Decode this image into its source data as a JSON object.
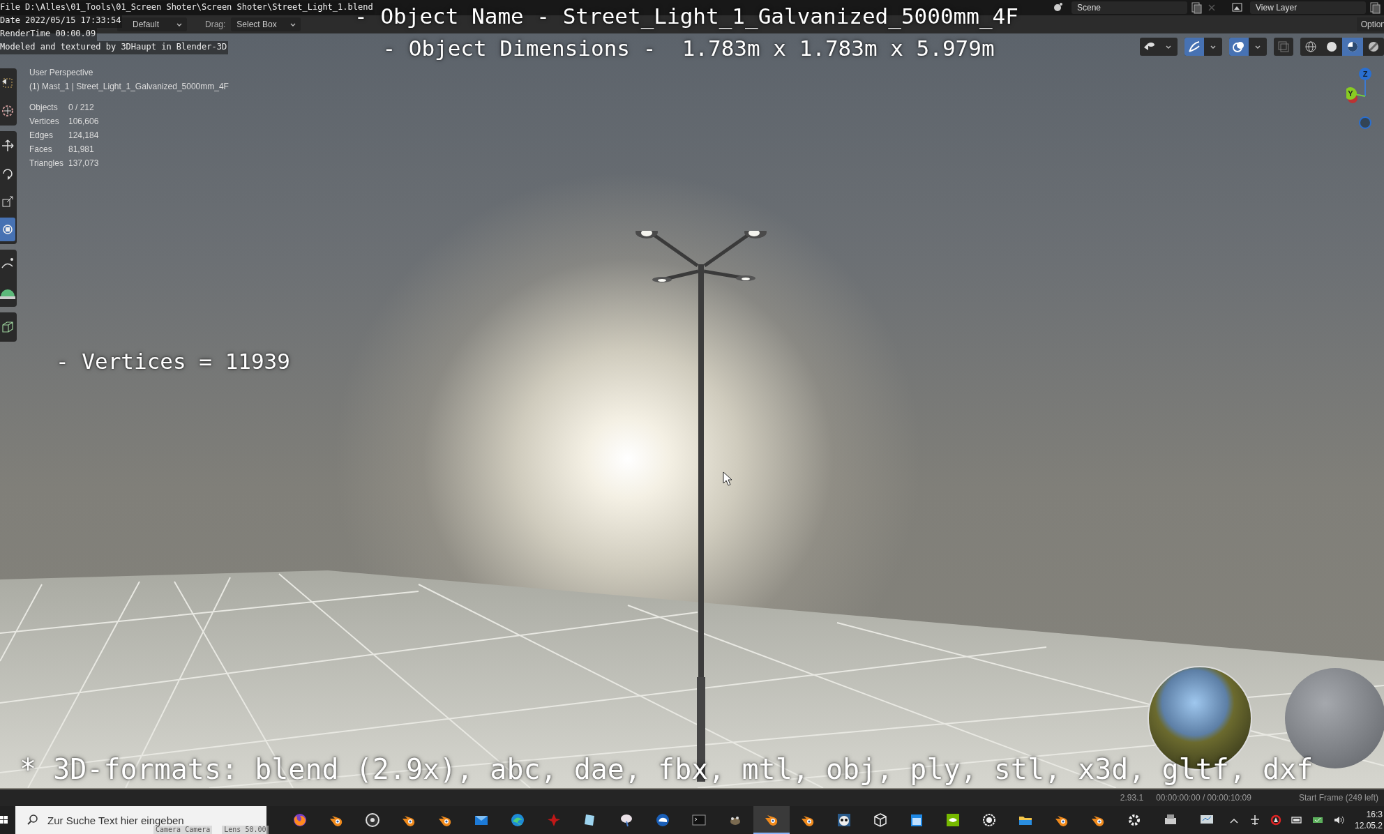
{
  "stamp": {
    "lines": [
      "File D:\\Alles\\01_Tools\\01_Screen Shoter\\Screen Shoter\\Street_Light_1.blend",
      "Date 2022/05/15 17:33:54",
      "RenderTime 00:00.09",
      "Modeled and textured by 3DHaupt in Blender-3D"
    ]
  },
  "header": {
    "pivot": "Default",
    "drag_label": "Drag:",
    "drag_value": "Select Box",
    "scene": "Scene",
    "view_layer": "View Layer",
    "options": "Option"
  },
  "captions": {
    "object_name": "- Object Name - Street_Light_1_Galvanized_5000mm_4F",
    "dimensions": "- Object Dimensions -  1.783m x 1.783m x 5.979m",
    "vertices": "- Vertices = 11939",
    "formats": "* 3D-formats: blend (2.9x), abc, dae, fbx, mtl, obj, ply, stl, x3d, gltf, dxf"
  },
  "viewport": {
    "view": "User Perspective",
    "object": "(1) Mast_1 | Street_Light_1_Galvanized_5000mm_4F",
    "stats": [
      {
        "label": "Objects",
        "value": "0 / 212"
      },
      {
        "label": "Vertices",
        "value": "106,606"
      },
      {
        "label": "Edges",
        "value": "124,184"
      },
      {
        "label": "Faces",
        "value": "81,981"
      },
      {
        "label": "Triangles",
        "value": "137,073"
      }
    ],
    "axes": [
      "Z",
      "Y"
    ]
  },
  "viewport_header": {
    "toggles": [
      {
        "kind": "visibility",
        "selected": false
      },
      {
        "kind": "gizmo",
        "selected": true
      },
      {
        "kind": "overlay",
        "selected": true
      },
      {
        "kind": "xray",
        "selected": false
      }
    ],
    "shading": [
      {
        "kind": "wire",
        "selected": false
      },
      {
        "kind": "solid",
        "selected": false
      },
      {
        "kind": "material",
        "selected": true
      },
      {
        "kind": "render",
        "selected": false
      }
    ]
  },
  "toolbar": [
    {
      "tools": [
        {
          "kind": "select",
          "selected": false
        },
        {
          "kind": "cursor",
          "selected": false
        }
      ]
    },
    {
      "tools": [
        {
          "kind": "move",
          "selected": false
        },
        {
          "kind": "rotate",
          "selected": false
        },
        {
          "kind": "scale",
          "selected": false
        },
        {
          "kind": "transform",
          "selected": true
        }
      ]
    },
    {
      "tools": [
        {
          "kind": "annotate",
          "selected": false
        },
        {
          "kind": "measure",
          "selected": false
        }
      ]
    },
    {
      "tools": [
        {
          "kind": "add",
          "selected": false
        }
      ]
    }
  ],
  "status": {
    "version": "2.93.1",
    "time": "00:00:00:00 / 00:00:10:09",
    "frame": "Start Frame (249 left)"
  },
  "taskbar": {
    "search_placeholder": "Zur Suche Text hier eingeben",
    "stamp_bits": [
      "Camera Camera",
      "Lens 50.00"
    ],
    "apps": [
      {
        "kind": "fox",
        "selected": false
      },
      {
        "kind": "blender",
        "selected": false
      },
      {
        "kind": "ring",
        "selected": false
      },
      {
        "kind": "blender",
        "selected": false
      },
      {
        "kind": "blender",
        "selected": false
      },
      {
        "kind": "mail",
        "selected": false
      },
      {
        "kind": "wave",
        "selected": false
      },
      {
        "kind": "bug",
        "selected": false
      },
      {
        "kind": "note",
        "selected": false
      },
      {
        "kind": "brush",
        "selected": false
      },
      {
        "kind": "cloud",
        "selected": false
      },
      {
        "kind": "terminal",
        "selected": false
      },
      {
        "kind": "critter",
        "selected": false
      },
      {
        "kind": "blender",
        "selected": true
      },
      {
        "kind": "blender",
        "selected": false
      },
      {
        "kind": "panda",
        "selected": false
      },
      {
        "kind": "cube",
        "selected": false
      },
      {
        "kind": "calendar",
        "selected": false
      },
      {
        "kind": "eye",
        "selected": false
      },
      {
        "kind": "dial",
        "selected": false
      },
      {
        "kind": "folder",
        "selected": false
      },
      {
        "kind": "blender",
        "selected": false
      },
      {
        "kind": "blender",
        "selected": false
      },
      {
        "kind": "gear",
        "selected": false
      },
      {
        "kind": "printer",
        "selected": false
      },
      {
        "kind": "monitor",
        "selected": false
      }
    ],
    "tray": [
      {
        "kind": "chevron"
      },
      {
        "kind": "network"
      },
      {
        "kind": "shield"
      },
      {
        "kind": "battery"
      },
      {
        "kind": "drive"
      },
      {
        "kind": "speaker"
      }
    ],
    "clock": "16:3",
    "date": "12.05.2"
  }
}
